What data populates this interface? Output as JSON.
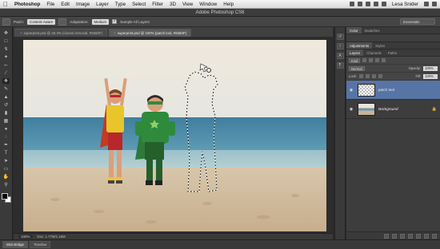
{
  "menubar": {
    "items": [
      "Photoshop",
      "File",
      "Edit",
      "Image",
      "Layer",
      "Type",
      "Select",
      "Filter",
      "3D",
      "View",
      "Window",
      "Help"
    ],
    "user": "Lesa Snider"
  },
  "appbar": {
    "title": "Adobe Photoshop CS6",
    "workspace": "Essentials"
  },
  "options": {
    "patch_label": "Patch:",
    "patch_value": "Content-Aware",
    "adaptation_label": "Adaptation:",
    "adaptation_value": "Medium",
    "sample_all_layers": "Sample All Layers"
  },
  "tabs": [
    {
      "label": "superprint.psd @ 33.3% (cloned removal, RGB/8*)",
      "active": false
    },
    {
      "label": "superprint.psd @ 100% (patch tool, RGB/8*)",
      "active": true
    }
  ],
  "status": {
    "zoom": "100%",
    "doc": "Doc: 1.77M/1.16M"
  },
  "bottom_tabs": [
    "Mini Bridge",
    "Timeline"
  ],
  "panels": {
    "top_tabs": [
      "Color",
      "Swatches"
    ],
    "mid_tabs": [
      "Adjustments",
      "Styles"
    ],
    "layer_tabs": [
      "Layers",
      "Channels",
      "Paths"
    ],
    "kind": "Kind",
    "blend": "Normal",
    "opacity_label": "Opacity:",
    "opacity_value": "100%",
    "lock_label": "Lock:",
    "fill_label": "Fill:",
    "fill_value": "100%",
    "layers": [
      {
        "name": "patch tool",
        "selected": true,
        "thumb": "trans"
      },
      {
        "name": "Background",
        "selected": false,
        "thumb": "photo"
      }
    ]
  },
  "colors": {
    "selection": "#5674a6",
    "panel_bg": "#454545",
    "app_bg": "#2b2b2b"
  }
}
